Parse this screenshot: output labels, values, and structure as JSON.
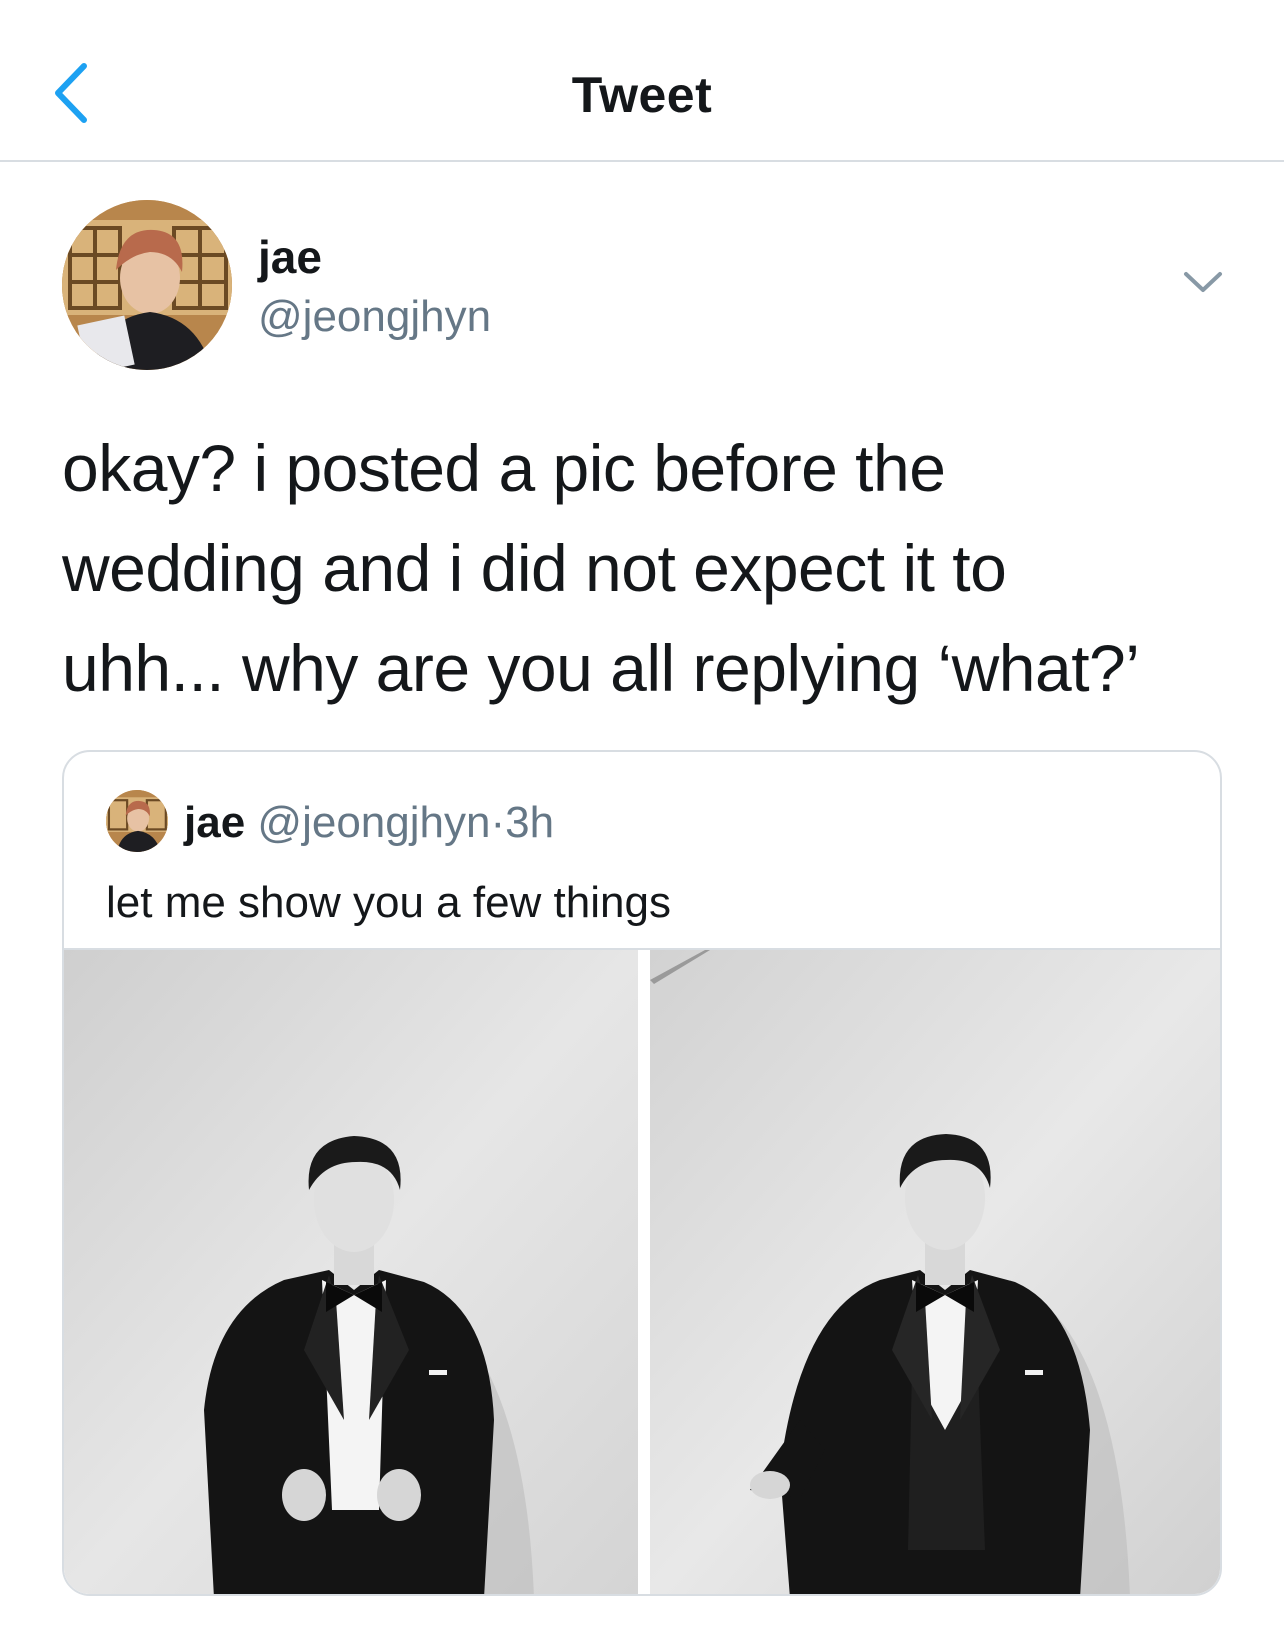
{
  "nav": {
    "title": "Tweet",
    "back_icon": "chevron-left-icon"
  },
  "tweet": {
    "author": {
      "name": "jae",
      "handle": "@jeongjhyn"
    },
    "text": "okay? i posted a pic before the\nwedding and i did not expect it to\nuhh... why are you all replying ‘what?’",
    "menu_icon": "chevron-down-icon"
  },
  "quote": {
    "author": {
      "name": "jae",
      "handle": "@jeongjhyn",
      "separator": "·",
      "time": "3h"
    },
    "text": "let me show you a few things",
    "media_count": 2
  },
  "colors": {
    "accent": "#1da1f2",
    "text_primary": "#14171a",
    "text_secondary": "#657786",
    "border": "#d8dde2"
  }
}
